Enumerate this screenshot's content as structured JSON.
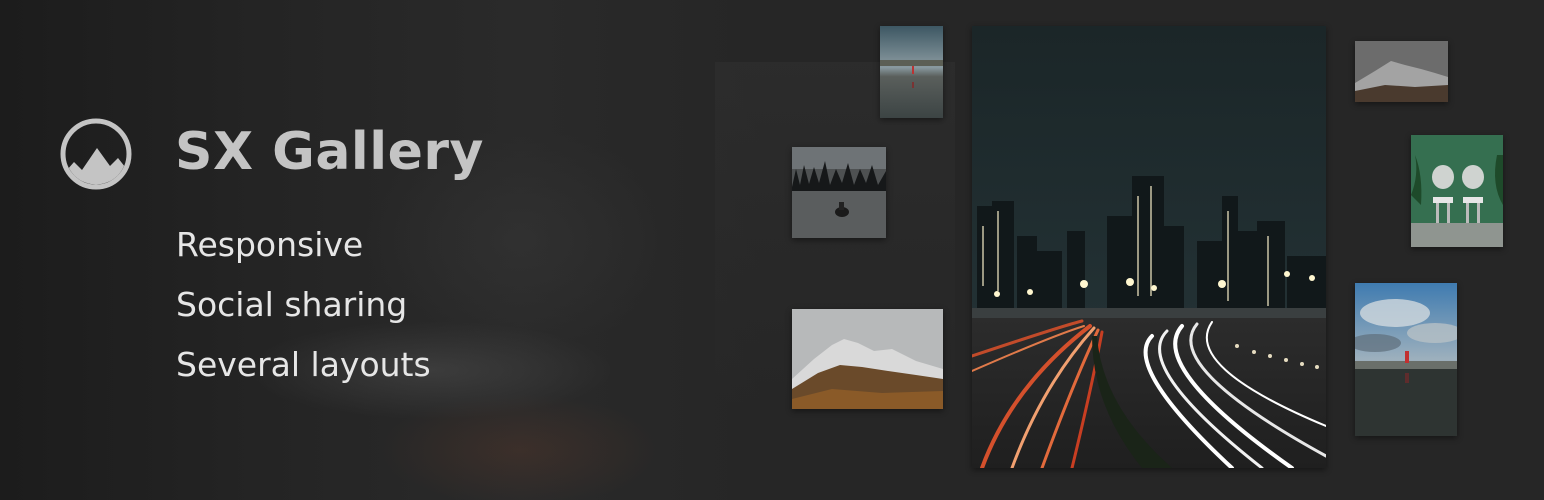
{
  "brand": {
    "title": "SX Gallery",
    "logo_icon": "mountain-circle-icon"
  },
  "features": [
    "Responsive",
    "Social sharing",
    "Several layouts"
  ],
  "colors": {
    "background": "#262626",
    "title": "#c4c4c4",
    "feature_text": "#e6e6e6"
  },
  "gallery": {
    "main_photo": "city-night-traffic-photo",
    "thumbnails": [
      "lake-reflection-photo",
      "snowmobile-forest-photo",
      "snowy-mountain-photo",
      "mountain-ridge-photo",
      "green-bathroom-photo",
      "cloudy-coast-photo"
    ]
  }
}
